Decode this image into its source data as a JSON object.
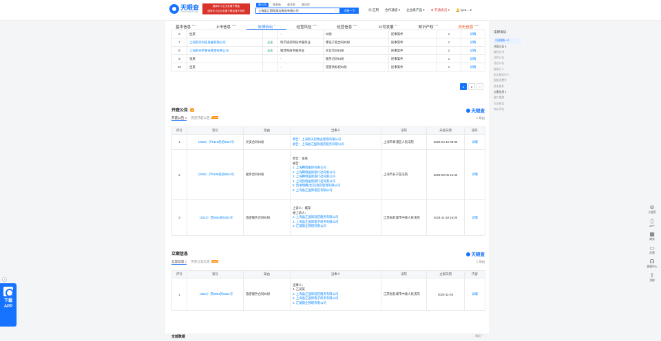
{
  "header": {
    "logo_text": "天眼查",
    "logo_sub": "TianYancha.com",
    "banner_line1": "国家中小企业发展子基金",
    "banner_line2": "国家中小企业发展子基金旗下机构",
    "scopes": [
      "查公司",
      "查老板",
      "查关系",
      "查风险"
    ],
    "search_value": "上海晶江国际酒店服务有限公司",
    "search_btn": "天眼一下",
    "nav": [
      "应用",
      "合作通道",
      "企业级产品",
      "开通会员",
      "tyc4..."
    ]
  },
  "subnav": [
    {
      "label": "基本信息",
      "count": "383"
    },
    {
      "label": "上市信息",
      "count": "999+"
    },
    {
      "label": "法律诉讼",
      "count": "8"
    },
    {
      "label": "经营风险",
      "count": "999+"
    },
    {
      "label": "经营信息",
      "count": "999+"
    },
    {
      "label": "公司发展",
      "count": "88"
    },
    {
      "label": "知识产权",
      "count": "137"
    },
    {
      "label": "历史信息",
      "count": "999+"
    }
  ],
  "prev_table": {
    "rows": [
      {
        "no": "6",
        "party": "住某",
        "tag": "",
        "role": "-",
        "cause": "纠纷",
        "type": "民事案件",
        "count": "1",
        "action": "详情"
      },
      {
        "no": "7",
        "party": "上海凯杰科技发展有限公司",
        "tag": "历史",
        "role": "科学研究和技术服务业",
        "cause": "建设工程合同纠纷",
        "type": "民事案件",
        "count": "1",
        "action": "详情"
      },
      {
        "no": "8",
        "party": "上海新天伦物业管理有限公司",
        "tag": "历史",
        "role": "租赁和商务服务业",
        "cause": "买卖合同纠纷",
        "type": "民事案件",
        "count": "2",
        "action": "详情"
      },
      {
        "no": "9",
        "party": "张某",
        "tag": "",
        "role": "-",
        "cause": "服务合同纠纷",
        "type": "民事案件",
        "count": "1",
        "action": "详情"
      },
      {
        "no": "10",
        "party": "吕某",
        "tag": "",
        "role": "-",
        "cause": "侵害商标权纠纷",
        "type": "民事案件",
        "count": "1",
        "action": "详情"
      }
    ],
    "pager": [
      "1",
      "2",
      "›"
    ]
  },
  "hearings": {
    "title": "开庭公告",
    "badge": "3",
    "brand": "天眼查",
    "tab1": "开庭公告",
    "tab1_count": "3",
    "tab2": "历史开庭公告",
    "tab2_count": "14",
    "new_tag": "NEW",
    "export": "导出",
    "headers": [
      "序号",
      "案号",
      "案由",
      "当事人",
      "法院",
      "开庭日期",
      "操作"
    ],
    "rows": [
      {
        "no": "1",
        "case_no": "（2025）沪0118民初5387号",
        "cause": "买卖合同纠纷",
        "parties": [
          "原告：上海新天伦物业管理有限公司",
          "被告：上海晶江国际酒店服务有限公司"
        ],
        "court": "上海市青浦区人民法院",
        "date": "2025-04-16 09:30",
        "action": "详情"
      },
      {
        "no": "2",
        "case_no": "（2025）沪0105民初6914号",
        "cause": "服务合同纠纷",
        "parties": [
          "原告：张某",
          "被告：",
          "1. 上海腾瑞服饰有限公司",
          "2. 上海腾瑞国际旅行社有限公司",
          "3. 上海腾瑞国际旅行社有限公司",
          "4. 上海凯瑞国际旅行社有限公司",
          "5. 凯瑞瑞腾(北京)酒店管理有限公司",
          "6. 上海晶江国际酒店有限公司"
        ],
        "court": "上海市长宁区法院",
        "date": "2025-03-06 14:40",
        "action": "详情"
      },
      {
        "no": "3",
        "case_no": "（2024）苏0981民5361号",
        "cause": "旅游服务合同纠纷",
        "parties": [
          "上诉人：臧某",
          "被上诉人：",
          "1. 上海晶江国际酒店服务有限公司",
          "2. 上海晶江国际电子商务有限公司",
          "3. 汇瑞旅业管理有限公司"
        ],
        "court": "江苏省盐城市中级人民法院",
        "date": "2024-11-19 15:00",
        "action": "详情"
      }
    ]
  },
  "filings": {
    "title": "立案信息",
    "brand": "天眼查",
    "tab1": "立案信息",
    "tab1_count": "1",
    "tab2": "历史立案信息",
    "tab2_count": "16",
    "new_tag": "NEW",
    "export": "导出",
    "headers": [
      "序号",
      "案号",
      "案由",
      "当事人",
      "法院",
      "立案日期",
      "内容"
    ],
    "rows": [
      {
        "no": "1",
        "case_no": "（2024）苏0981民5361号",
        "cause": "旅游服务合同纠纷",
        "parties": [
          "当事人：",
          "1. 乙某某",
          "2. 上海晶江国际酒店服务有限公司",
          "3. 上海晶江国际电子商务有限公司",
          "4. 汇瑞旅业管理有限公司"
        ],
        "court": "江苏省盐城市中级人民法院",
        "date": "2024-11-04",
        "action": "详情"
      }
    ]
  },
  "footer_section": "全部数据",
  "fold": "收起 ^",
  "outline": {
    "title": "法律诉讼",
    "items": [
      "司法解析 10",
      "开庭公告 3",
      "裁判文书",
      "法院公告",
      "送达公告",
      "被执行人",
      "失信被执行人",
      "限制消费令",
      "终本案件",
      "立案信息 1",
      "破产重整",
      "司法拍卖",
      "询价评估"
    ]
  },
  "tools": [
    "小程序",
    "APP",
    "商务",
    "反馈",
    "客服中心",
    "顶部"
  ],
  "app_download": {
    "line1": "下载",
    "line2": "APP"
  }
}
